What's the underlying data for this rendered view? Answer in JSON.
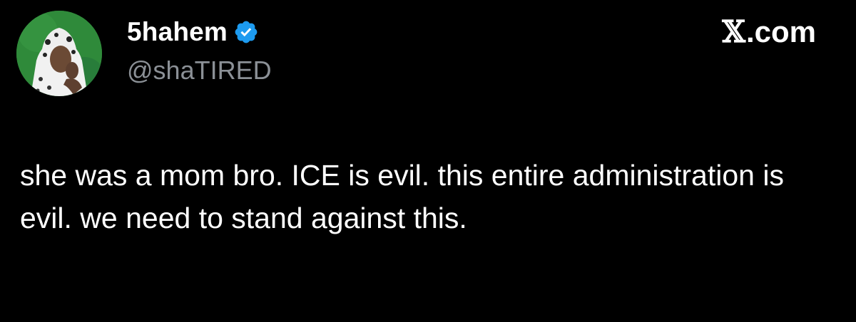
{
  "author": {
    "display_name": "5hahem",
    "handle": "@shaTIRED",
    "verified": true,
    "verified_icon": "verified-badge-icon",
    "avatar_icon": "profile-avatar"
  },
  "source": {
    "x_mark": "𝕏",
    "domain": ".com"
  },
  "tweet": {
    "text": "she was a mom bro. ICE is evil. this entire administration is evil. we need to stand against this."
  },
  "colors": {
    "background": "#000000",
    "text": "#ffffff",
    "handle": "#8b9096",
    "verified": "#1d9bf0",
    "avatar_bg": "#2f8a3a"
  }
}
